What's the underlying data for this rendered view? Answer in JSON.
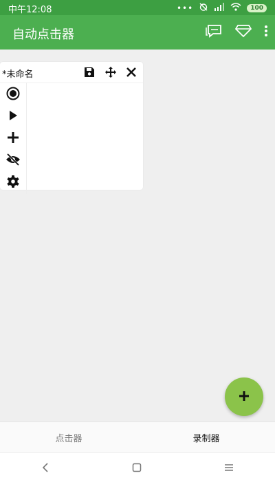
{
  "status_bar": {
    "time": "中午12:08",
    "battery": "100"
  },
  "app_bar": {
    "title": "自动点击器",
    "icons": [
      "chat-icon",
      "diamond-icon",
      "more-vert-icon"
    ]
  },
  "panel": {
    "title": "*未命名",
    "tool_icons": [
      "save-icon",
      "move-icon",
      "close-icon"
    ],
    "side_icons": [
      "record-icon",
      "play-icon",
      "add-icon",
      "eye-off-icon",
      "gear-icon"
    ]
  },
  "fab": {
    "icon": "plus-icon"
  },
  "bottom_nav": {
    "tabs": [
      {
        "label": "点击器",
        "active": false
      },
      {
        "label": "录制器",
        "active": true
      }
    ]
  },
  "system_nav": {
    "icons": [
      "back-icon",
      "home-icon",
      "menu-icon"
    ]
  },
  "colors": {
    "status_bar": "#3d9f42",
    "app_bar": "#4caf50",
    "fab": "#8bc34a",
    "background": "#efefef"
  }
}
